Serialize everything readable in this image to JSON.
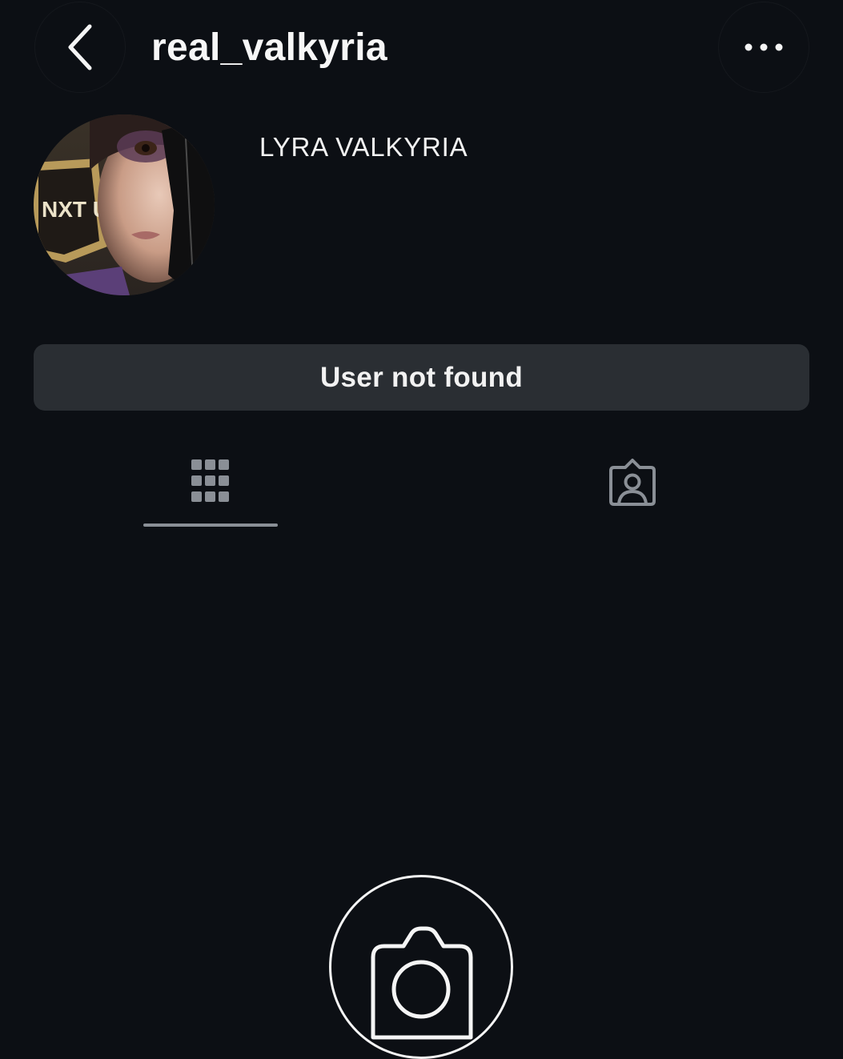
{
  "header": {
    "back_icon": "chevron-left-icon",
    "username": "real_valkyria",
    "more_icon": "more-horizontal-icon"
  },
  "profile": {
    "display_name": "LYRA VALKYRIA",
    "avatar_logo_text": "NXT UK"
  },
  "status": {
    "message": "User not found"
  },
  "tabs": [
    {
      "icon": "grid-icon",
      "active": true
    },
    {
      "icon": "tagged-person-icon",
      "active": false
    }
  ],
  "empty_state": {
    "icon": "camera-icon"
  },
  "colors": {
    "background": "#0c0f14",
    "status_box": "#2a2e33",
    "tab_icon": "#8a8f96",
    "text": "#f5f5f5"
  }
}
